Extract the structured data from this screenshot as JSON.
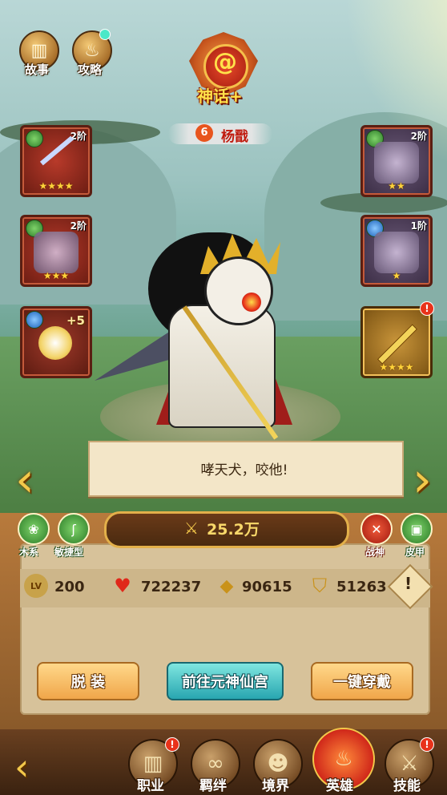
{
  "top_menu": {
    "story": "故事",
    "guide": "攻略"
  },
  "hero": {
    "rank": "神话+",
    "level_badge": "6",
    "name": "杨戬",
    "dialogue": "哮天犬，咬他!"
  },
  "equipment": {
    "left": [
      {
        "tier": "2阶",
        "stars": "★★★★"
      },
      {
        "tier": "2阶",
        "stars": "★★★"
      },
      {
        "tier": "+5",
        "stars": ""
      }
    ],
    "right": [
      {
        "tier": "2阶",
        "stars": "★★"
      },
      {
        "tier": "1阶",
        "stars": "★"
      },
      {
        "tier": "",
        "stars": "★★★★"
      }
    ]
  },
  "traits": {
    "element": "木系",
    "type": "敏捷型",
    "talent": "战神",
    "armor": "皮甲"
  },
  "power": "25.2万",
  "stats": {
    "level_icon": "LV",
    "level": "200",
    "hp": "722237",
    "attack": "90615",
    "defense": "51263"
  },
  "buttons": {
    "unequip": "脱 装",
    "goto_palace": "前往元神仙宫",
    "equip_all": "一键穿戴"
  },
  "nav": {
    "profession": "职业",
    "bond": "羁绊",
    "realm": "境界",
    "hero": "英雄",
    "skill": "技能"
  },
  "colors": {
    "accent_gold": "#f3c84a",
    "power_text": "#f8d86a",
    "name_red": "#c01a0e",
    "nav_active": "#d0281a"
  }
}
